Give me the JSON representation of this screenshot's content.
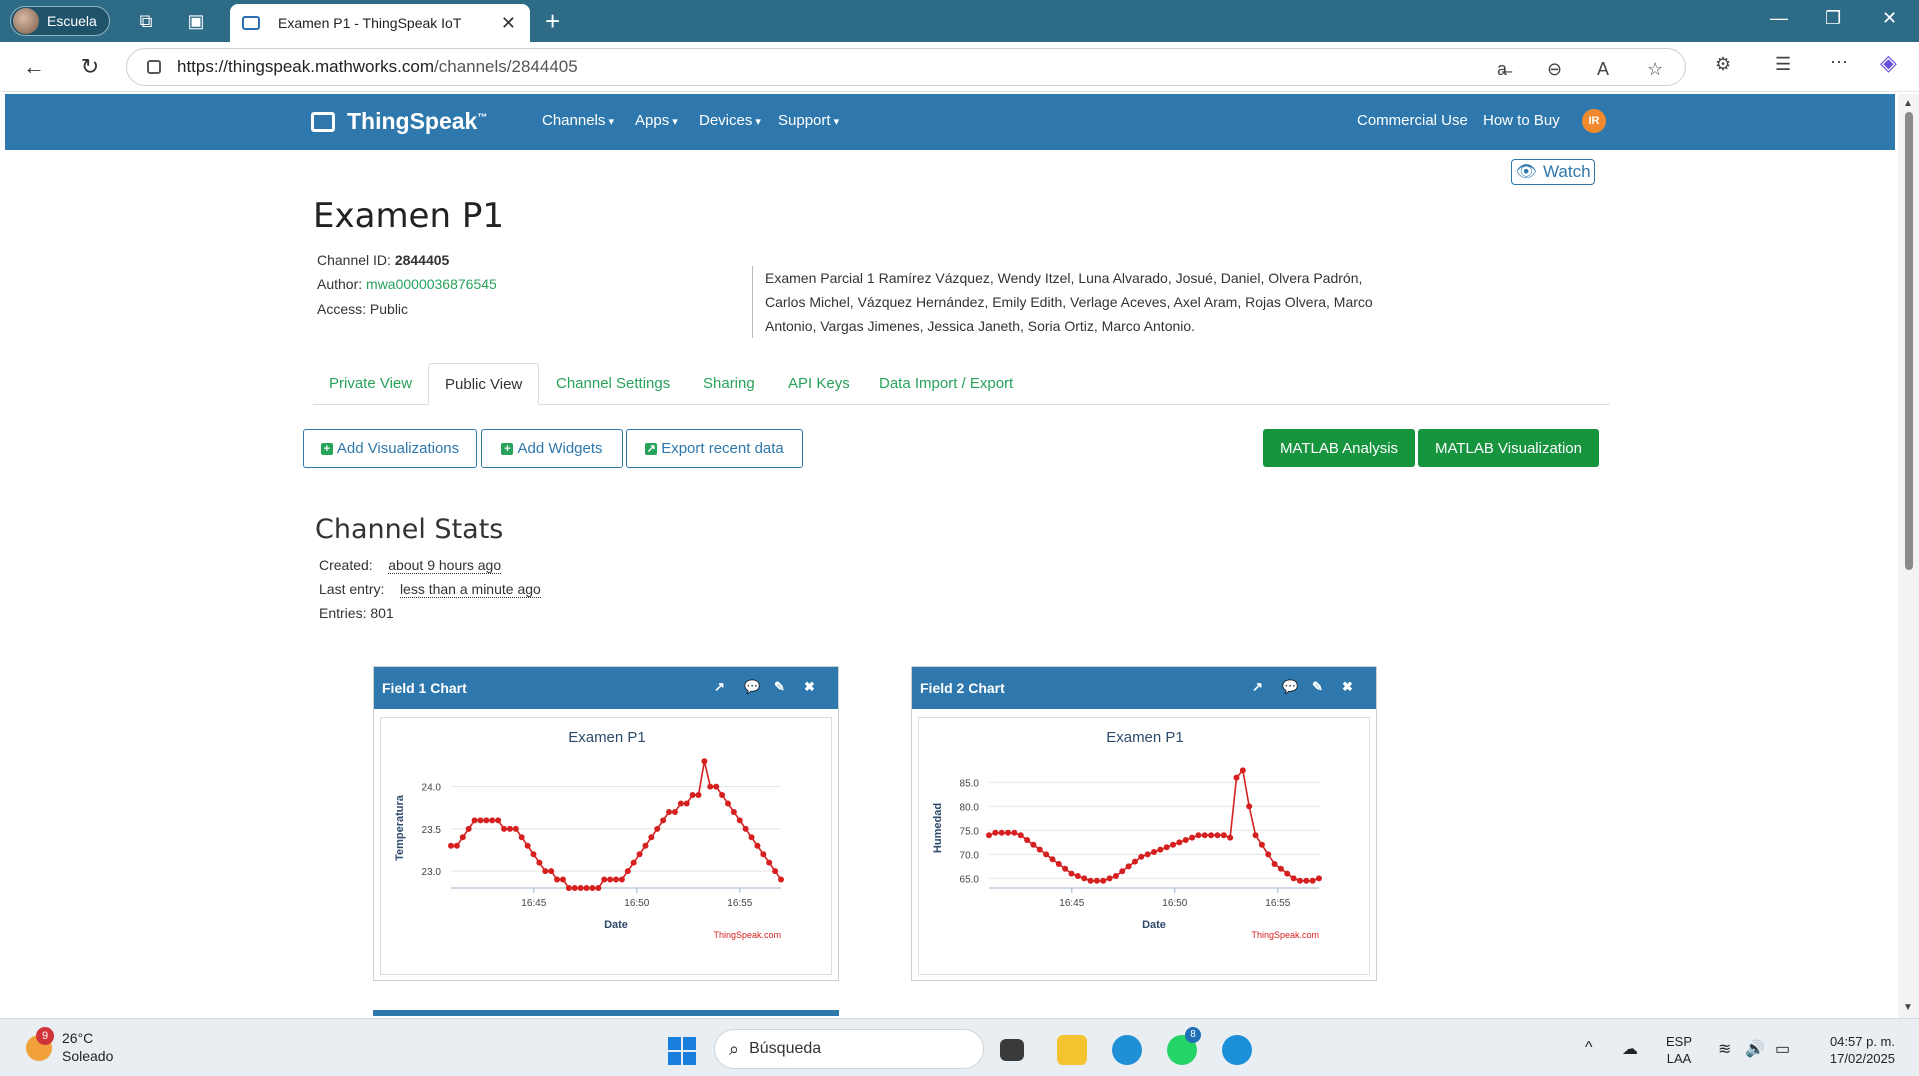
{
  "browser": {
    "profile_label": "Escuela",
    "tab_title": "Examen P1 - ThingSpeak IoT",
    "url_host": "https://thingspeak.mathworks.com",
    "url_path": "/channels/2844405"
  },
  "header": {
    "logo": "ThingSpeak",
    "logo_tm": "™",
    "menu": [
      "Channels",
      "Apps",
      "Devices",
      "Support"
    ],
    "commercial": "Commercial Use",
    "how_to_buy": "How to Buy",
    "avatar": "IR"
  },
  "channel": {
    "watch": "Watch",
    "title": "Examen P1",
    "id_label": "Channel ID:",
    "id_value": "2844405",
    "author_label": "Author:",
    "author_value": "mwa0000036876545",
    "access_label": "Access:",
    "access_value": "Public",
    "description": "Examen Parcial 1 Ramírez Vázquez, Wendy Itzel, Luna Alvarado, Josué, Daniel, Olvera Padrón, Carlos Michel, Vázquez Hernández, Emily Edith, Verlage Aceves, Axel Aram, Rojas Olvera, Marco Antonio, Vargas Jimenes, Jessica Janeth, Soria Ortiz, Marco Antonio."
  },
  "tabs": [
    "Private View",
    "Public View",
    "Channel Settings",
    "Sharing",
    "API Keys",
    "Data Import / Export"
  ],
  "active_tab": "Public View",
  "actions": {
    "add_vis": "Add Visualizations",
    "add_widgets": "Add Widgets",
    "export": "Export recent data",
    "matlab_analysis": "MATLAB Analysis",
    "matlab_vis": "MATLAB Visualization"
  },
  "stats": {
    "title": "Channel Stats",
    "created_label": "Created:",
    "created_value": "about 9 hours ago",
    "last_label": "Last entry:",
    "last_value": "less than a minute ago",
    "entries_label": "Entries:",
    "entries_value": "801"
  },
  "widgets": [
    {
      "header": "Field 1 Chart"
    },
    {
      "header": "Field 2 Chart"
    }
  ],
  "chart_data": [
    {
      "type": "line",
      "title": "Examen P1",
      "xlabel": "Date",
      "ylabel": "Temperatura",
      "credit": "ThingSpeak.com",
      "color": "#d62020",
      "x_ticks": [
        "16:45",
        "16:50",
        "16:55"
      ],
      "y_ticks": [
        23.0,
        23.5,
        24.0
      ],
      "ylim": [
        22.8,
        24.22
      ],
      "xlim": [
        16.683,
        16.95
      ],
      "values": [
        23.3,
        23.3,
        23.4,
        23.5,
        23.6,
        23.6,
        23.6,
        23.6,
        23.6,
        23.5,
        23.5,
        23.5,
        23.4,
        23.3,
        23.2,
        23.1,
        23.0,
        23.0,
        22.9,
        22.9,
        22.8,
        22.8,
        22.8,
        22.8,
        22.8,
        22.8,
        22.9,
        22.9,
        22.9,
        22.9,
        23.0,
        23.1,
        23.2,
        23.3,
        23.4,
        23.5,
        23.6,
        23.7,
        23.7,
        23.8,
        23.8,
        23.9,
        23.9,
        24.3,
        24.0,
        24.0,
        23.9,
        23.8,
        23.7,
        23.6,
        23.5,
        23.4,
        23.3,
        23.2,
        23.1,
        23.0,
        22.9
      ]
    },
    {
      "type": "line",
      "title": "Examen P1",
      "xlabel": "Date",
      "ylabel": "Humedad",
      "credit": "ThingSpeak.com",
      "color": "#d62020",
      "x_ticks": [
        "16:45",
        "16:50",
        "16:55"
      ],
      "y_ticks": [
        65.0,
        70.0,
        75.0,
        80.0,
        85.0
      ],
      "ylim": [
        63.0,
        88.0
      ],
      "xlim": [
        16.683,
        16.95
      ],
      "values": [
        74.0,
        74.5,
        74.5,
        74.5,
        74.5,
        74.0,
        73.0,
        72.0,
        71.0,
        70.0,
        69.0,
        68.0,
        67.0,
        66.0,
        65.5,
        65.0,
        64.5,
        64.5,
        64.5,
        65.0,
        65.5,
        66.5,
        67.5,
        68.5,
        69.5,
        70.0,
        70.5,
        71.0,
        71.5,
        72.0,
        72.5,
        73.0,
        73.5,
        74.0,
        74.0,
        74.0,
        74.0,
        74.0,
        73.5,
        86.0,
        87.5,
        80.0,
        74.0,
        72.0,
        70.0,
        68.0,
        67.0,
        66.0,
        65.0,
        64.5,
        64.5,
        64.5,
        65.0
      ]
    }
  ],
  "taskbar": {
    "temp": "26°C",
    "weather": "Soleado",
    "weather_badge": "9",
    "search": "Búsqueda",
    "whatsapp_badge": "8",
    "lang": "ESP",
    "lang2": "LAA",
    "time": "04:57 p. m.",
    "date": "17/02/2025"
  }
}
